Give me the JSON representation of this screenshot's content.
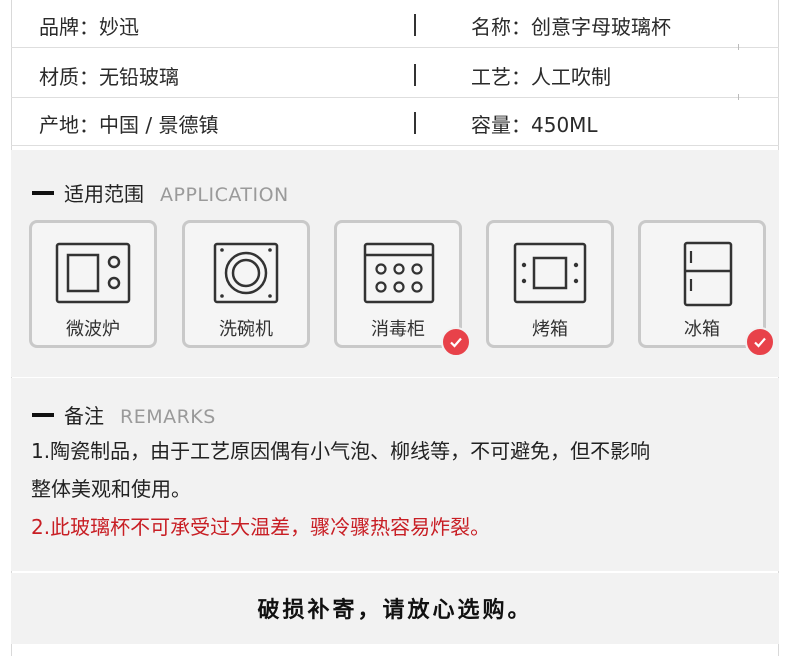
{
  "specs": [
    {
      "left": "品牌：妙迅",
      "right": "名称：创意字母玻璃杯"
    },
    {
      "left": "材质：无铅玻璃",
      "right": "工艺：人工吹制"
    },
    {
      "left": "产地：中国 / 景德镇",
      "right": "容量：450ML"
    }
  ],
  "application": {
    "title_cn": "适用范围",
    "title_en": "APPLICATION",
    "items": [
      {
        "label": "微波炉",
        "icon": "microwave-icon",
        "checked": false
      },
      {
        "label": "洗碗机",
        "icon": "dishwasher-icon",
        "checked": false
      },
      {
        "label": "消毒柜",
        "icon": "sterilizer-cabinet-icon",
        "checked": true
      },
      {
        "label": "烤箱",
        "icon": "oven-icon",
        "checked": false
      },
      {
        "label": "冰箱",
        "icon": "refrigerator-icon",
        "checked": true
      }
    ]
  },
  "remarks": {
    "title_cn": "备注",
    "title_en": "REMARKS",
    "line1": "1.陶瓷制品，由于工艺原因偶有小气泡、柳线等，不可避免，但不影响",
    "line1b": "整体美观和使用。",
    "line2": "2.此玻璃杯不可承受过大温差，骤冷骤热容易炸裂。"
  },
  "footer": "破损补寄，请放心选购。",
  "colors": {
    "accent_red": "#e8424a",
    "warning_text": "#c81e24"
  }
}
